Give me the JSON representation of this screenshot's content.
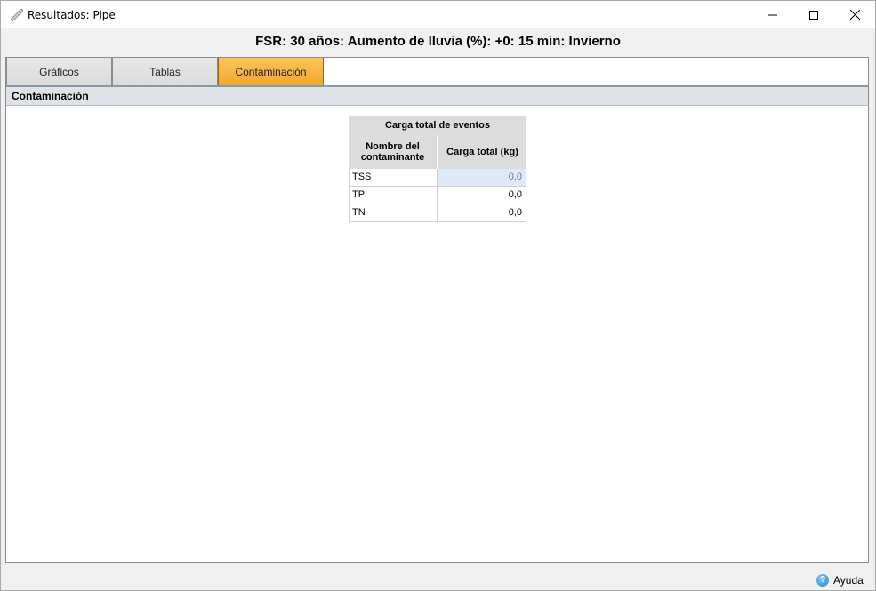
{
  "window": {
    "title": "Resultados: Pipe",
    "icon": "pipe-icon"
  },
  "header": {
    "title": "FSR: 30 años: Aumento de lluvia (%): +0: 15 min: Invierno"
  },
  "tabs": [
    {
      "label": "Gráficos",
      "active": false
    },
    {
      "label": "Tablas",
      "active": false
    },
    {
      "label": "Contaminación",
      "active": true
    }
  ],
  "section": {
    "title": "Contaminación"
  },
  "table": {
    "group_header": "Carga total de eventos",
    "columns": [
      "Nombre del contaminante",
      "Carga total (kg)"
    ],
    "rows": [
      {
        "name": "TSS",
        "value": "0,0"
      },
      {
        "name": "TP",
        "value": "0,0"
      },
      {
        "name": "TN",
        "value": "0,0"
      }
    ]
  },
  "footer": {
    "help_label": "Ayuda",
    "help_icon_glyph": "?"
  },
  "colors": {
    "active_tab": "#f3a72c",
    "selected_cell": "#deeafa"
  }
}
